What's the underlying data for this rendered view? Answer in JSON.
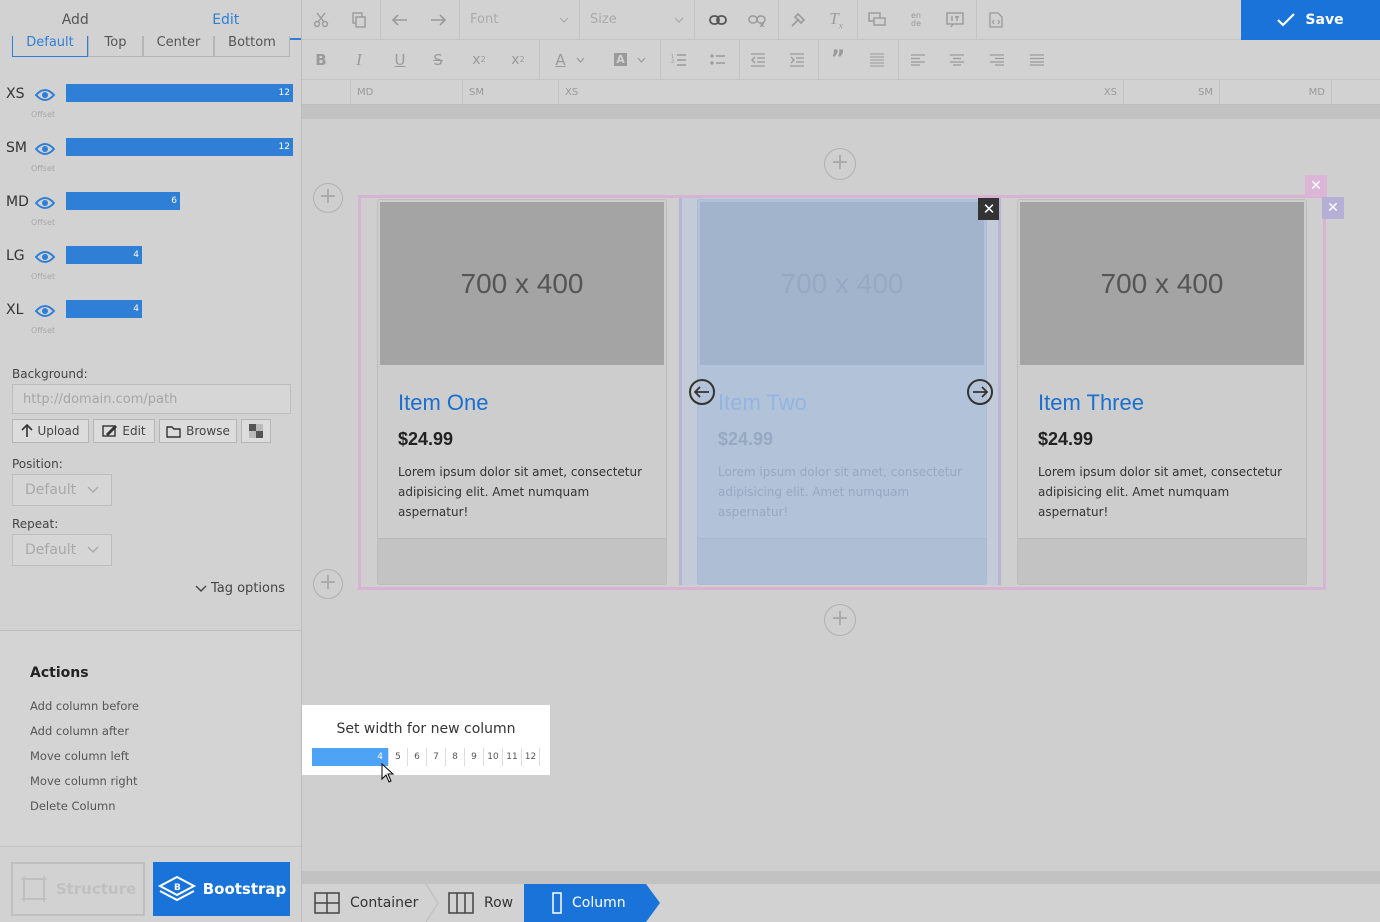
{
  "sidebar": {
    "tabs": [
      {
        "label": "Add"
      },
      {
        "label": "Edit"
      }
    ],
    "subtabs": [
      "Default",
      "Top",
      "Center",
      "Bottom"
    ],
    "breakpoints": [
      {
        "label": "XS",
        "value": "12",
        "offset": "Offset"
      },
      {
        "label": "SM",
        "value": "12",
        "offset": "Offset"
      },
      {
        "label": "MD",
        "value": "6",
        "offset": "Offset"
      },
      {
        "label": "LG",
        "value": "4",
        "offset": "Offset"
      },
      {
        "label": "XL",
        "value": "4",
        "offset": "Offset"
      }
    ],
    "background_label": "Background:",
    "background_placeholder": "http://domain.com/path",
    "upload_label": "Upload",
    "edit_label": "Edit",
    "browse_label": "Browse",
    "position_label": "Position:",
    "position_value": "Default",
    "repeat_label": "Repeat:",
    "repeat_value": "Default",
    "tag_options": "Tag options",
    "actions_title": "Actions",
    "actions": [
      "Add column before",
      "Add column after",
      "Move column left",
      "Move column right",
      "Delete Column"
    ],
    "structure_label": "Structure",
    "bootstrap_label": "Bootstrap"
  },
  "toolbar": {
    "font_placeholder": "Font",
    "size_placeholder": "Size",
    "save_label": "Save",
    "lang_label_top": "en",
    "lang_label_bottom": "de"
  },
  "ruler": {
    "left": [
      "MD",
      "SM",
      "XS"
    ],
    "right": [
      "XS",
      "SM",
      "MD"
    ]
  },
  "cards": [
    {
      "image_text": "700 x 400",
      "title": "Item One",
      "price": "$24.99",
      "desc": "Lorem ipsum dolor sit amet, consectetur adipisicing elit. Amet numquam aspernatur!"
    },
    {
      "image_text": "700 x 400",
      "title": "Item Two",
      "price": "$24.99",
      "desc": "Lorem ipsum dolor sit amet, consectetur adipisicing elit. Amet numquam aspernatur!"
    },
    {
      "image_text": "700 x 400",
      "title": "Item Three",
      "price": "$24.99",
      "desc": "Lorem ipsum dolor sit amet, consectetur adipisicing elit. Amet numquam aspernatur!"
    }
  ],
  "width_popup": {
    "title": "Set width for new column",
    "selected": "4",
    "options": [
      "5",
      "6",
      "7",
      "8",
      "9",
      "10",
      "11",
      "12"
    ]
  },
  "breadcrumb": [
    {
      "label": "Container"
    },
    {
      "label": "Row"
    },
    {
      "label": "Column"
    }
  ],
  "colors": {
    "accent": "#1a73d9",
    "bar_blue": "#2f7fd6",
    "row_outline": "#d8b4d4",
    "selected_col": "#b7c2d1"
  }
}
